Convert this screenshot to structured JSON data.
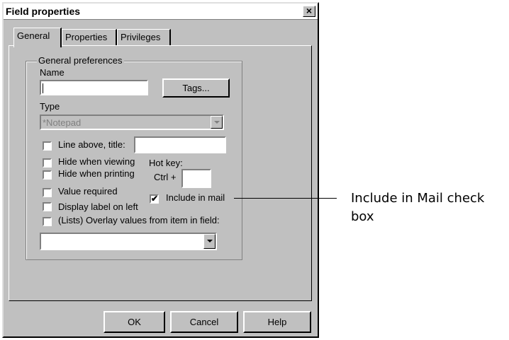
{
  "window": {
    "title": "Field properties",
    "close_glyph": "×"
  },
  "tabs": [
    {
      "label": "General",
      "active": true
    },
    {
      "label": "Properties",
      "active": false
    },
    {
      "label": "Privileges",
      "active": false
    }
  ],
  "general": {
    "group_label": "General preferences",
    "name_label": "Name",
    "name_value": "",
    "tags_button": "Tags...",
    "type_label": "Type",
    "type_value": "*Notepad",
    "type_disabled": true,
    "line_above": {
      "label": "Line above, title:",
      "checked": false,
      "value": ""
    },
    "hide_viewing": {
      "label": "Hide when viewing",
      "checked": false
    },
    "hide_printing": {
      "label": "Hide when printing",
      "checked": false
    },
    "value_required": {
      "label": "Value required",
      "checked": false
    },
    "display_label_left": {
      "label": "Display label on left",
      "checked": false
    },
    "overlay_values": {
      "label": "(Lists) Overlay values from item in field:",
      "checked": false
    },
    "overlay_field_value": "",
    "hotkey_label": "Hot key:",
    "hotkey_prefix": "Ctrl +",
    "hotkey_value": "",
    "include_in_mail": {
      "label": "Include in mail",
      "checked": true
    }
  },
  "buttons": {
    "ok": "OK",
    "cancel": "Cancel",
    "help": "Help"
  },
  "callout": {
    "text": "Include in Mail check box"
  },
  "icons": {
    "checkmark": "✔",
    "dropdown": "chevron-down-icon"
  }
}
